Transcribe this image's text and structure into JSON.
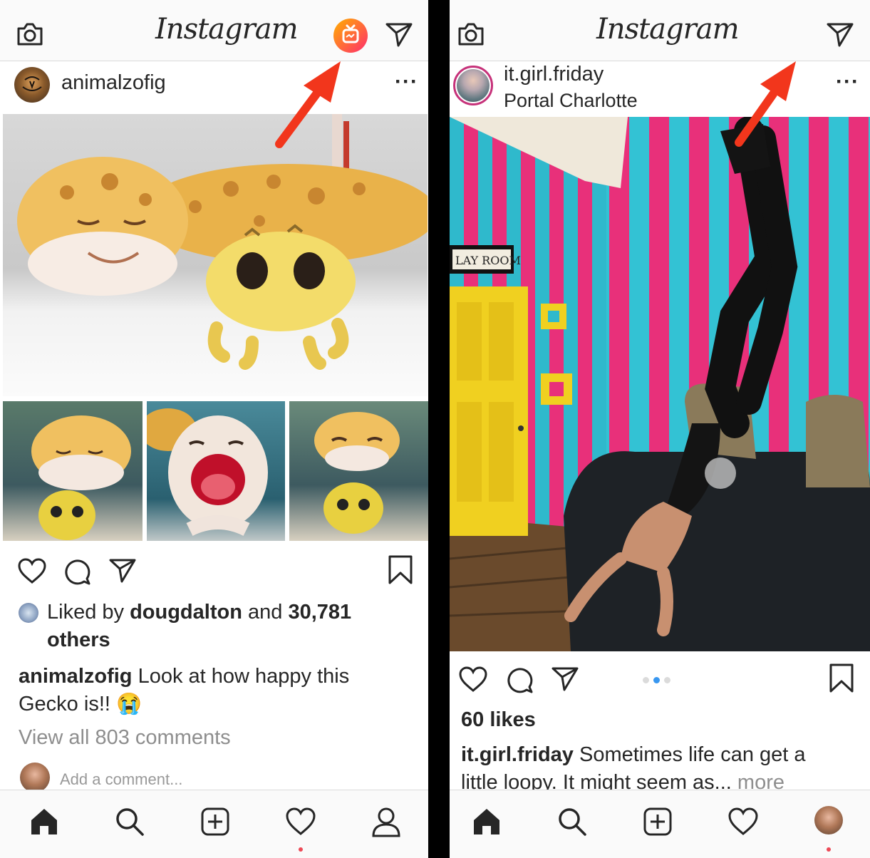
{
  "left": {
    "header": {
      "logo": "Instagram",
      "icons": [
        "camera-icon",
        "igtv-icon",
        "direct-icon"
      ]
    },
    "post": {
      "username": "animalzofig",
      "more_label": "···",
      "liked_prefix": "Liked by",
      "liked_user": "dougdalton",
      "liked_and": "and",
      "liked_count": "30,781",
      "liked_suffix": "others",
      "caption_user": "animalzofig",
      "caption_text_1": "Look at how happy this",
      "caption_text_2": "Gecko is!! 😭",
      "view_comments": "View all 803 comments",
      "comment_placeholder": "Add a comment..."
    },
    "tabbar": {
      "icons": [
        "home-icon",
        "search-icon",
        "add-post-icon",
        "activity-heart-icon",
        "profile-icon"
      ]
    }
  },
  "right": {
    "header": {
      "logo": "Instagram",
      "icons": [
        "camera-icon",
        "direct-icon"
      ]
    },
    "post": {
      "username": "it.girl.friday",
      "location": "Portal Charlotte",
      "more_label": "···",
      "likes": "60 likes",
      "caption_user": "it.girl.friday",
      "caption_text_1": "Sometimes life can get a",
      "caption_text_2": "little loopy. It might seem as...",
      "caption_more": "more",
      "sign_text": "LAY ROOM",
      "carousel_active_index": 2,
      "carousel_count": 3
    },
    "tabbar": {
      "icons": [
        "home-icon",
        "search-icon",
        "add-post-icon",
        "activity-heart-icon",
        "profile-avatar"
      ]
    }
  },
  "colors": {
    "annotation_arrow": "#f2361c",
    "igtv_gradient_start": "#ffb000",
    "igtv_gradient_end": "#ff2c6d",
    "link_blue": "#3897f0",
    "notification_dot": "#ed4956"
  }
}
